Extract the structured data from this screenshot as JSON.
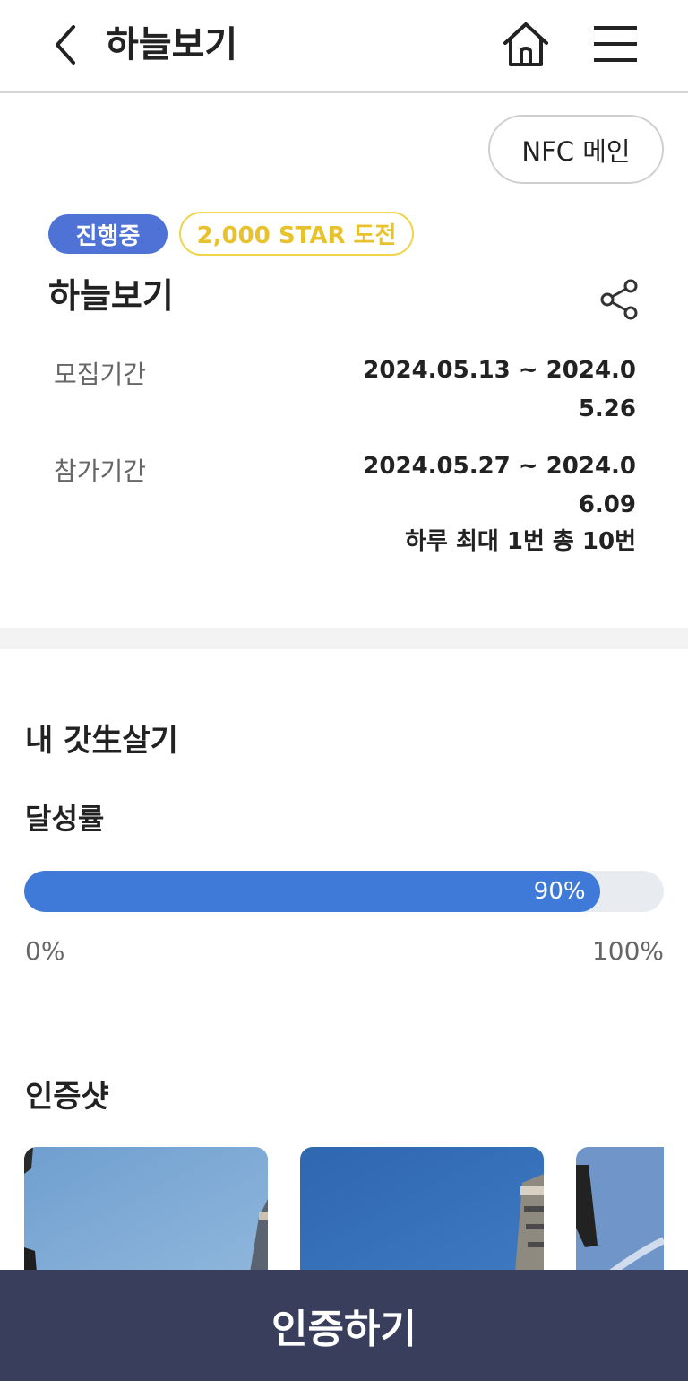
{
  "header": {
    "title": "하늘보기",
    "back_icon": "chevron-left-icon",
    "home_icon": "home-icon",
    "menu_icon": "hamburger-menu-icon"
  },
  "nfc_button": "NFC 메인",
  "badges": {
    "status": "진행중",
    "reward": "2,000 STAR 도전",
    "status_color": "#4e72d6",
    "reward_color": "#e8c22c"
  },
  "challenge": {
    "title": "하늘보기",
    "share_icon": "share-icon",
    "recruit_label": "모집기간",
    "recruit_value": "2024.05.13 ~ 2024.05.26",
    "participate_label": "참가기간",
    "participate_value": "2024.05.27 ~ 2024.06.09",
    "frequency": "하루 최대 1번 총 10번"
  },
  "my_section": {
    "title": "내 갓生살기",
    "achievement_label": "달성률",
    "progress_percent": 90,
    "progress_text": "90%",
    "scale_min": "0%",
    "scale_max": "100%",
    "progress_color": "#3f7ad9"
  },
  "proof_section": {
    "title": "인증샷",
    "photos": [
      "sky-photo-1",
      "sky-photo-2",
      "sky-photo-3"
    ]
  },
  "cta_button": "인증하기",
  "cta_color": "#383e5c"
}
